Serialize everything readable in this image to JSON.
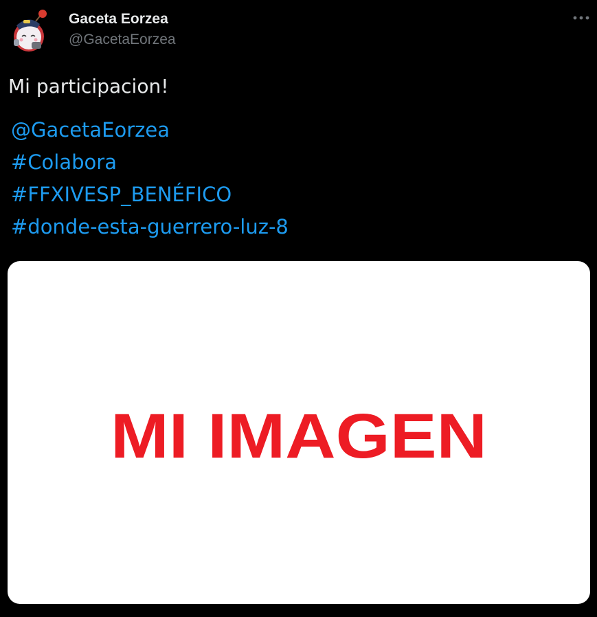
{
  "tweet": {
    "author": {
      "display_name": "Gaceta Eorzea",
      "handle": "@GacetaEorzea"
    },
    "text": "Mi participacion!",
    "links": [
      "@GacetaEorzea",
      "#Colabora",
      "#FFXIVESP_BENÉFICO",
      "#donde-esta-guerrero-luz-8"
    ],
    "media": {
      "image_text": "MI IMAGEN",
      "image_text_color": "#ed1c24",
      "background_color": "#ffffff"
    }
  },
  "icons": {
    "more": "more-horizontal-icon",
    "avatar": "moogle-avatar"
  },
  "colors": {
    "background": "#000000",
    "primary_text": "#e7e9ea",
    "secondary_text": "#71767b",
    "link": "#1d9bf0"
  }
}
